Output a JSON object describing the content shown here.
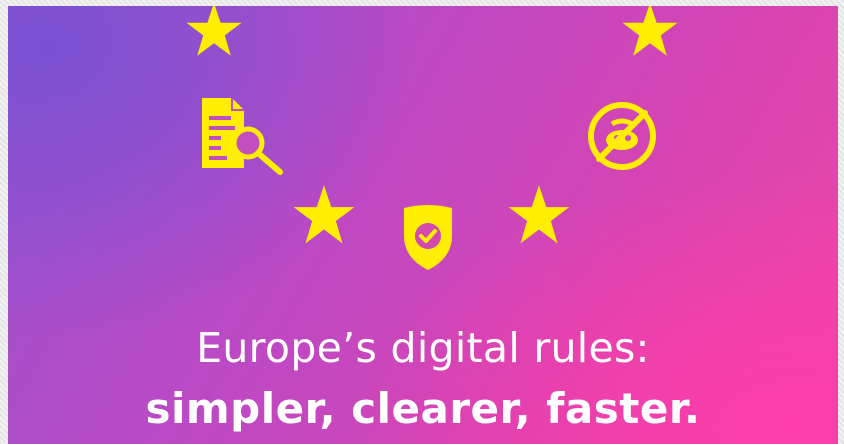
{
  "colors": {
    "star": "#ffee00",
    "icon": "#ffee00",
    "text": "#ffffff",
    "gradient_start": "#9a54cf",
    "gradient_end": "#ee47a6"
  },
  "icons": [
    "star-icon",
    "document-search-icon",
    "shield-check-icon",
    "no-tracking-icon"
  ],
  "headline": {
    "line1": "Europe’s digital rules:",
    "line2": "simpler, clearer, faster."
  }
}
